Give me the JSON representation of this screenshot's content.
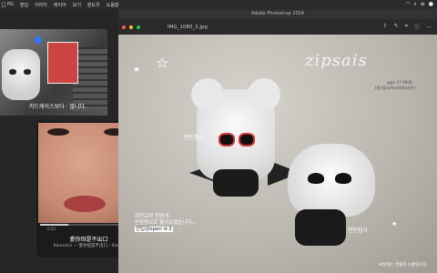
{
  "menubar": {
    "items": [
      "PG",
      "편집",
      "이미지",
      "레이어",
      "보기",
      "윈도우",
      "도움말"
    ],
    "sys_icons": [
      "wifi-icon",
      "search-icon",
      "control-center-icon",
      "user-icon"
    ]
  },
  "photoshop": {
    "window_title": "Adobe Photoshop 2024",
    "file_tab": "IMG_1080_2.jpg",
    "toolbar_icons": [
      "share-icon",
      "edit-icon",
      "crop-icon",
      "info-icon",
      "more-icon"
    ]
  },
  "left_thumb": {
    "caption": "카드케이스보다 · 많니다."
  },
  "music": {
    "time_elapsed": "0:52",
    "time_remaining": "-2:06",
    "progress": 0.29,
    "title": "愛你但是不出口",
    "artist": "Karencici — 愛你但是不出口 - Single"
  },
  "canvas": {
    "signature": "zipsais",
    "note_lines": [
      "pgcs 17-0000",
      "(제진집사/미사/미미/사진)"
    ],
    "label_a": "변인집사",
    "label_b": "천인집사",
    "lyrics_line1": "회전교자 천원네",
    "lyrics_line2": "빈장원으로 돌아오겠습니다...",
    "lyrics_line3": "선입금open d-3",
    "credit": "※날개는 연출된 소품입니다."
  },
  "colors": {
    "accent": "#3478f6",
    "traffic_close": "#ff5f57",
    "traffic_min": "#febc2e",
    "traffic_max": "#28c840"
  }
}
